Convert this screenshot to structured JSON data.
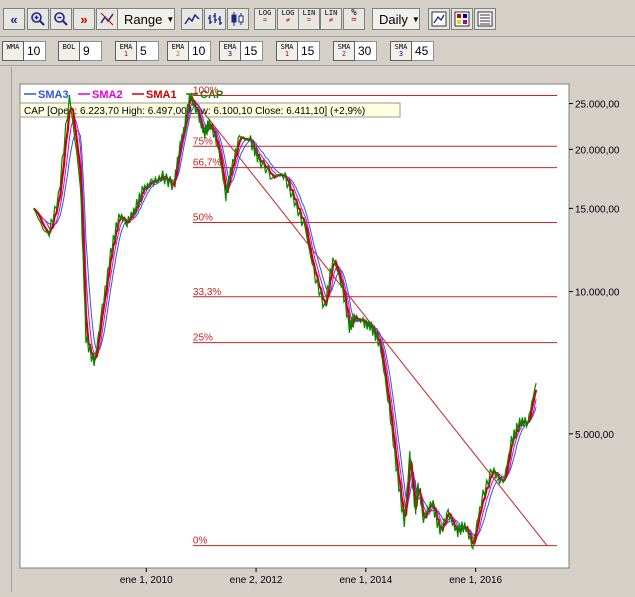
{
  "toolbar": {
    "range_label": "Range",
    "period_label": "Daily",
    "log1": [
      "LOG",
      "="
    ],
    "log2": [
      "LOG",
      "≠"
    ],
    "lin1": [
      "LIN",
      "="
    ],
    "lin2": [
      "LIN",
      "≠"
    ],
    "pct": [
      "%",
      "="
    ]
  },
  "indicators": [
    {
      "name": "WMA",
      "sub": "",
      "value": "10"
    },
    {
      "name": "BOL",
      "sub": "",
      "value": "9"
    },
    {
      "name": "EMA",
      "sub": "1",
      "value": "5"
    },
    {
      "name": "EMA",
      "sub": "2",
      "value": "10"
    },
    {
      "name": "EMA",
      "sub": "3",
      "value": "15"
    },
    {
      "name": "SMA",
      "sub": "1",
      "value": "15"
    },
    {
      "name": "SMA",
      "sub": "2",
      "value": "30"
    },
    {
      "name": "SMA",
      "sub": "3",
      "value": "45"
    }
  ],
  "chart_data": {
    "type": "line",
    "scale": "log",
    "legend": [
      {
        "name": "SMA3",
        "color": "#3355dd"
      },
      {
        "name": "SMA2",
        "color": "#dd00dd"
      },
      {
        "name": "SMA1",
        "color": "#cc0000"
      },
      {
        "name": "CAP",
        "color": "#008800"
      }
    ],
    "info": "CAP [Open: 6.223,70  High: 6.497,00  Low: 6.100,10  Close: 6.411,10] (+2,9%)",
    "y_ticks": [
      "25.000,00",
      "20.000,00",
      "15.000,00",
      "10.000,00",
      "5.000,00"
    ],
    "y_tick_values": [
      25000,
      20000,
      15000,
      10000,
      5000
    ],
    "x_ticks": [
      "ene 1, 2010",
      "ene 2, 2012",
      "ene 1, 2014",
      "ene 1, 2016"
    ],
    "x_tick_years": [
      2010.0,
      2012.0,
      2014.0,
      2016.0
    ],
    "ylim": [
      2600,
      27500
    ],
    "xlim": [
      2007.7,
      2017.7
    ],
    "fibonacci": {
      "levels": [
        "100%",
        "75%",
        "66,7%",
        "50%",
        "33,3%",
        "25%",
        "0%"
      ],
      "prices": [
        26000,
        20300,
        18300,
        14000,
        9750,
        7800,
        2900
      ],
      "color": "#cc2222"
    },
    "trendline": {
      "from": [
        2010.8,
        26000
      ],
      "to": [
        2017.3,
        2900
      ]
    },
    "series": [
      {
        "name": "CAP",
        "x": [
          2007.95,
          2008.2,
          2008.4,
          2008.6,
          2008.8,
          2008.9,
          2009.05,
          2009.2,
          2009.35,
          2009.5,
          2009.65,
          2009.8,
          2009.95,
          2010.1,
          2010.3,
          2010.5,
          2010.6,
          2010.7,
          2010.8,
          2010.95,
          2011.05,
          2011.15,
          2011.3,
          2011.45,
          2011.55,
          2011.7,
          2011.9,
          2012.05,
          2012.3,
          2012.5,
          2012.7,
          2012.9,
          2013.05,
          2013.25,
          2013.4,
          2013.55,
          2013.7,
          2013.8,
          2013.95,
          2014.1,
          2014.25,
          2014.4,
          2014.55,
          2014.7,
          2014.8,
          2014.9,
          2014.95,
          2015.05,
          2015.2,
          2015.35,
          2015.5,
          2015.65,
          2015.8,
          2015.95,
          2016.1,
          2016.3,
          2016.5,
          2016.65,
          2016.8,
          2016.95,
          2017.1
        ],
        "values": [
          15000,
          13000,
          15800,
          26000,
          17000,
          8000,
          7000,
          9200,
          12000,
          14500,
          14000,
          15000,
          16500,
          17000,
          17500,
          16800,
          20000,
          22500,
          26000,
          23500,
          21500,
          22800,
          20500,
          16000,
          18200,
          21200,
          20800,
          19000,
          17500,
          17800,
          15500,
          13500,
          11000,
          9200,
          11800,
          10500,
          8400,
          8800,
          8600,
          8400,
          7800,
          6000,
          4300,
          3200,
          4500,
          3400,
          3900,
          3300,
          3600,
          3100,
          3400,
          3100,
          3200,
          2900,
          3600,
          4200,
          3900,
          4800,
          5300,
          5300,
          6400
        ]
      }
    ]
  }
}
